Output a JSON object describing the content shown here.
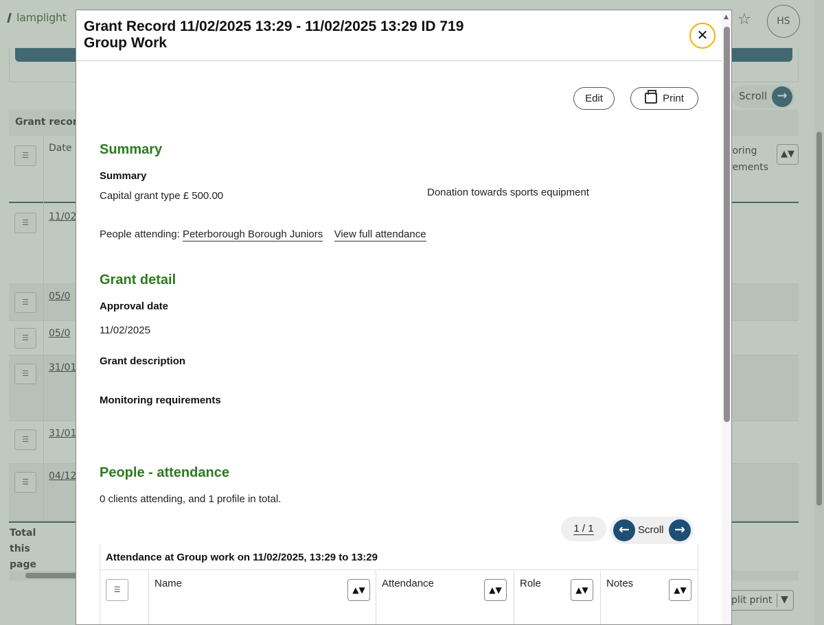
{
  "app": {
    "logo_text": "lamplight",
    "avatar_initials": "HS"
  },
  "background": {
    "scroll_label": "Scroll",
    "table_title": "Grant record",
    "col_date": "Date",
    "col_monitoring": "toring\nrements",
    "rows": [
      "11/02",
      "05/0",
      "05/0",
      "31/01",
      "31/01",
      "04/12"
    ],
    "total_label": "Total\nthis\npage",
    "split_print_label": "plit print"
  },
  "modal": {
    "title_line1": "Grant Record 11/02/2025 13:29 - 11/02/2025 13:29 ID 719",
    "title_line2": "Group Work",
    "close_label": "✕",
    "edit_label": "Edit",
    "print_label": "Print",
    "summary": {
      "heading": "Summary",
      "label": "Summary",
      "grant_type_value": "Capital grant type £ 500.00",
      "description_value": "Donation towards sports equipment",
      "people_attending_prefix": "People attending:",
      "people_attending_link": "Peterborough Borough Juniors",
      "view_full_attendance": "View full attendance"
    },
    "grant_detail": {
      "heading": "Grant detail",
      "approval_date_label": "Approval date",
      "approval_date_value": "11/02/2025",
      "grant_description_label": "Grant description",
      "monitoring_label": "Monitoring requirements"
    },
    "attendance": {
      "heading": "People - attendance",
      "summary_text": "0 clients attending, and 1 profile in total.",
      "pager": "1 / 1",
      "scroll_label": "Scroll",
      "table_caption": "Attendance at Group work on 11/02/2025, 13:29 to 13:29",
      "columns": [
        "Name",
        "Attendance",
        "Role",
        "Notes"
      ]
    }
  },
  "colors": {
    "accent_green": "#2d7a1f",
    "brand_blue": "#1d4f74",
    "close_ring": "#f0b400"
  }
}
